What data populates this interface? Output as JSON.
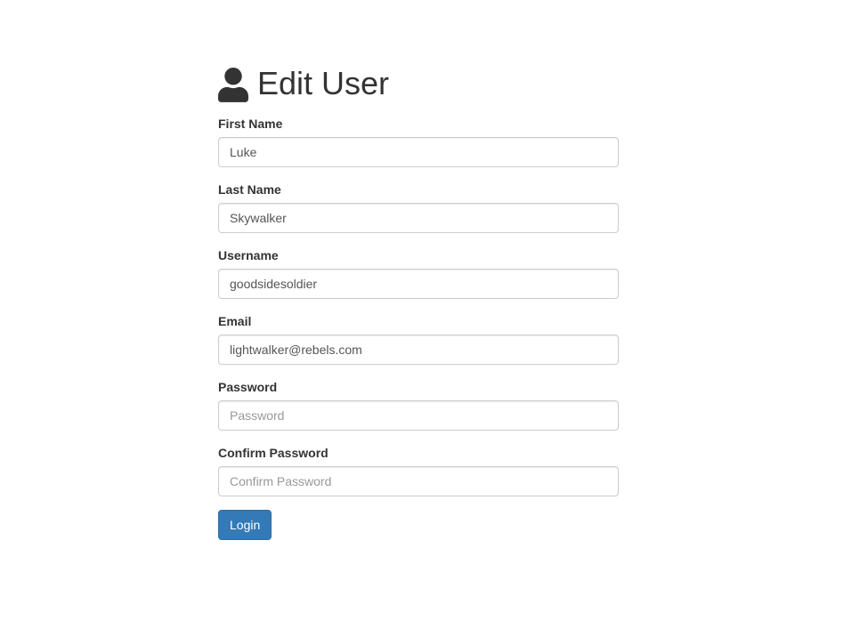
{
  "header": {
    "title": "Edit User"
  },
  "form": {
    "first_name": {
      "label": "First Name",
      "value": "Luke"
    },
    "last_name": {
      "label": "Last Name",
      "value": "Skywalker"
    },
    "username": {
      "label": "Username",
      "value": "goodsidesoldier"
    },
    "email": {
      "label": "Email",
      "value": "lightwalker@rebels.com"
    },
    "password": {
      "label": "Password",
      "placeholder": "Password"
    },
    "confirm_password": {
      "label": "Confirm Password",
      "placeholder": "Confirm Password"
    },
    "submit_label": "Login"
  }
}
